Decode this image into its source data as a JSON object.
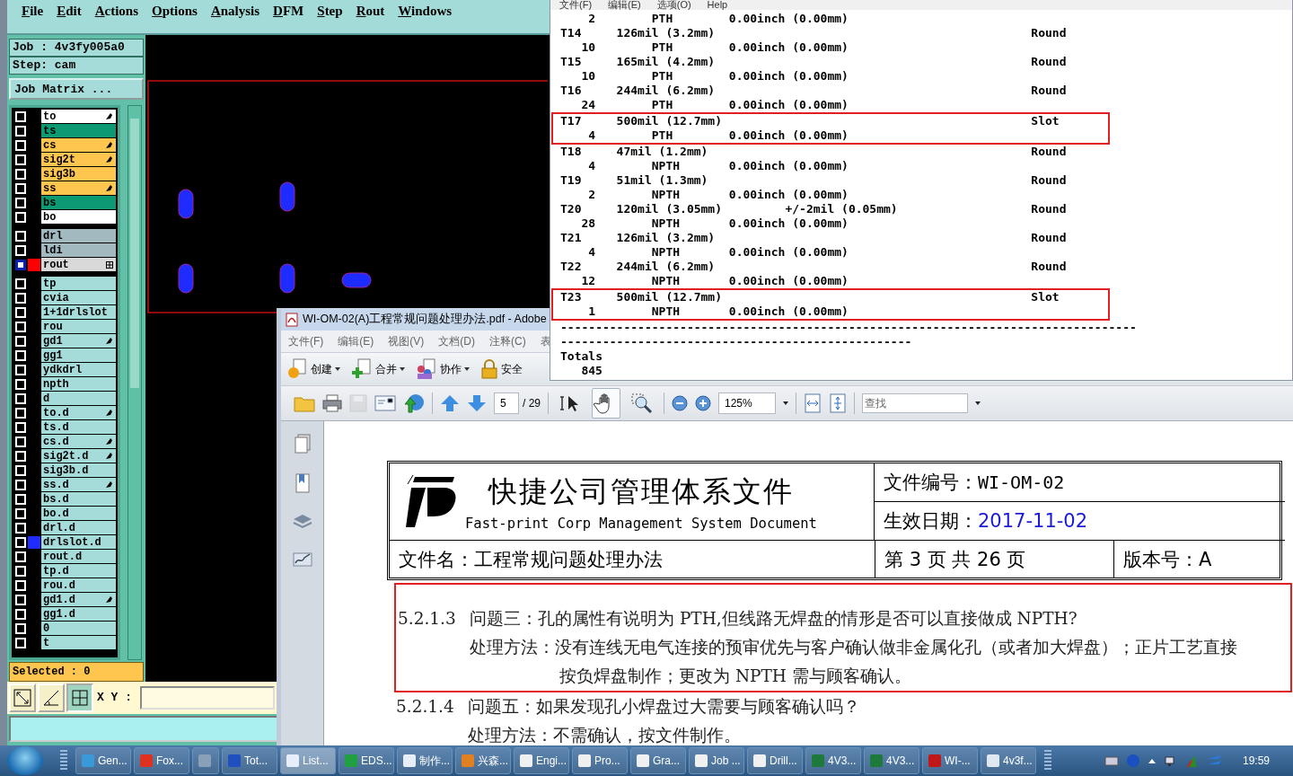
{
  "genesis": {
    "menu": [
      "File",
      "Edit",
      "Actions",
      "Options",
      "Analysis",
      "DFM",
      "Step",
      "Rout",
      "Windows"
    ],
    "job_label": "Job : 4v3fy005a0",
    "step_label": "Step: cam",
    "job_matrix_button": "Job Matrix ...",
    "layer_groups": [
      [
        {
          "name": "to",
          "color": "#ffffff",
          "kind": "hand",
          "active": false
        },
        {
          "name": "ts",
          "color": "#0c9a72",
          "kind": "plain",
          "active": false
        },
        {
          "name": "cs",
          "color": "#ffc64f",
          "kind": "hand",
          "active": false
        },
        {
          "name": "sig2t",
          "color": "#ffc64f",
          "kind": "hand",
          "active": false
        },
        {
          "name": "sig3b",
          "color": "#ffc64f",
          "kind": "plain",
          "active": false
        },
        {
          "name": "ss",
          "color": "#ffc64f",
          "kind": "hand",
          "active": false
        },
        {
          "name": "bs",
          "color": "#0c9a72",
          "kind": "plain",
          "active": false
        },
        {
          "name": "bo",
          "color": "#ffffff",
          "kind": "plain",
          "active": false
        }
      ],
      [
        {
          "name": "drl",
          "color": "#a3b9c0",
          "kind": "plain",
          "active": false
        },
        {
          "name": "ldi",
          "color": "#a3b9c0",
          "kind": "plain",
          "active": false
        },
        {
          "name": "rout",
          "color": "#d9d9d9",
          "swatch": {
            "color": "#ff0000"
          },
          "kind": "grid",
          "active": true
        }
      ],
      [
        {
          "name": "tp",
          "color": "#a5dcd9",
          "kind": "plain",
          "active": false
        },
        {
          "name": "cvia",
          "color": "#a5dcd9",
          "kind": "plain",
          "active": false
        },
        {
          "name": "1+1drlslot",
          "color": "#a5dcd9",
          "kind": "plain",
          "active": false
        },
        {
          "name": "rou",
          "color": "#a5dcd9",
          "kind": "plain",
          "active": false
        },
        {
          "name": "gd1",
          "color": "#a5dcd9",
          "kind": "hand",
          "active": false
        },
        {
          "name": "gg1",
          "color": "#a5dcd9",
          "kind": "plain",
          "active": false
        },
        {
          "name": "ydkdrl",
          "color": "#a5dcd9",
          "kind": "plain",
          "active": false
        },
        {
          "name": "npth",
          "color": "#a5dcd9",
          "kind": "plain",
          "active": false
        },
        {
          "name": "d",
          "color": "#a5dcd9",
          "kind": "plain",
          "active": false
        },
        {
          "name": "to.d",
          "color": "#a5dcd9",
          "kind": "hand",
          "active": false
        },
        {
          "name": "ts.d",
          "color": "#a5dcd9",
          "kind": "plain",
          "active": false
        },
        {
          "name": "cs.d",
          "color": "#a5dcd9",
          "kind": "hand",
          "active": false
        },
        {
          "name": "sig2t.d",
          "color": "#a5dcd9",
          "kind": "hand",
          "active": false
        },
        {
          "name": "sig3b.d",
          "color": "#a5dcd9",
          "kind": "plain",
          "active": false
        },
        {
          "name": "ss.d",
          "color": "#a5dcd9",
          "kind": "hand",
          "active": false
        },
        {
          "name": "bs.d",
          "color": "#a5dcd9",
          "kind": "plain",
          "active": false
        },
        {
          "name": "bo.d",
          "color": "#a5dcd9",
          "kind": "plain",
          "active": false
        },
        {
          "name": "drl.d",
          "color": "#a5dcd9",
          "kind": "plain",
          "active": false
        },
        {
          "name": "drlslot.d",
          "color": "#a5dcd9",
          "swatch": {
            "color": "#1f2cff"
          },
          "kind": "plain",
          "active": false
        },
        {
          "name": "rout.d",
          "color": "#a5dcd9",
          "kind": "plain",
          "active": false
        },
        {
          "name": "tp.d",
          "color": "#a5dcd9",
          "kind": "plain",
          "active": false
        },
        {
          "name": "rou.d",
          "color": "#a5dcd9",
          "kind": "plain",
          "active": false
        },
        {
          "name": "gd1.d",
          "color": "#a5dcd9",
          "kind": "hand",
          "active": false
        },
        {
          "name": "gg1.d",
          "color": "#a5dcd9",
          "kind": "plain",
          "active": false
        },
        {
          "name": "0",
          "color": "#a5dcd9",
          "kind": "plain",
          "active": false
        },
        {
          "name": "t",
          "color": "#a5dcd9",
          "kind": "plain",
          "active": false
        }
      ]
    ],
    "selected_label": "Selected : 0",
    "tool_buttons": [
      {
        "kind": "zoom-fit",
        "selected": false
      },
      {
        "kind": "measure",
        "selected": false
      },
      {
        "kind": "grid",
        "selected": true
      }
    ],
    "coordinates_label": "X Y :"
  },
  "report": {
    "menu": [
      "文件(F)",
      "编辑(E)",
      "选项(O)",
      "Help"
    ],
    "entries": [
      {
        "count": "2",
        "type": "PTH",
        "plating": "0.00inch (0.00mm)",
        "highlighted": false
      },
      {
        "tool": "T14",
        "size": "126mil (3.2mm)",
        "shape": "Round",
        "count": "10",
        "type": "PTH",
        "plating": "0.00inch (0.00mm)",
        "highlighted": false
      },
      {
        "tool": "T15",
        "size": "165mil (4.2mm)",
        "shape": "Round",
        "count": "10",
        "type": "PTH",
        "plating": "0.00inch (0.00mm)",
        "highlighted": false
      },
      {
        "tool": "T16",
        "size": "244mil (6.2mm)",
        "shape": "Round",
        "count": "24",
        "type": "PTH",
        "plating": "0.00inch (0.00mm)",
        "highlighted": false
      },
      {
        "tool": "T17",
        "size": "500mil (12.7mm)",
        "shape": "Slot",
        "count": "4",
        "type": "PTH",
        "plating": "0.00inch (0.00mm)",
        "highlighted": true
      },
      {
        "tool": "T18",
        "size": "47mil (1.2mm)",
        "shape": "Round",
        "count": "4",
        "type": "NPTH",
        "plating": "0.00inch (0.00mm)",
        "highlighted": false
      },
      {
        "tool": "T19",
        "size": "51mil (1.3mm)",
        "shape": "Round",
        "count": "2",
        "type": "NPTH",
        "plating": "0.00inch (0.00mm)",
        "highlighted": false
      },
      {
        "tool": "T20",
        "size": "120mil (3.05mm)",
        "tolerance": "+/-2mil (0.05mm)",
        "shape": "Round",
        "count": "28",
        "type": "NPTH",
        "plating": "0.00inch (0.00mm)",
        "highlighted": false
      },
      {
        "tool": "T21",
        "size": "126mil (3.2mm)",
        "shape": "Round",
        "count": "4",
        "type": "NPTH",
        "plating": "0.00inch (0.00mm)",
        "highlighted": false
      },
      {
        "tool": "T22",
        "size": "244mil (6.2mm)",
        "shape": "Round",
        "count": "12",
        "type": "NPTH",
        "plating": "0.00inch (0.00mm)",
        "highlighted": false
      },
      {
        "tool": "T23",
        "size": "500mil (12.7mm)",
        "shape": "Slot",
        "count": "1",
        "type": "NPTH",
        "plating": "0.00inch (0.00mm)",
        "highlighted": true
      }
    ],
    "rules": [
      "----------------------------------------------------------------------------------",
      "--------------------------------------------------"
    ],
    "totals_label": "Totals",
    "totals_value": "845"
  },
  "pdf": {
    "title": "WI-OM-02(A)工程常规问题处理办法.pdf - Adobe",
    "menu": [
      "文件(F)",
      "编辑(E)",
      "视图(V)",
      "文档(D)",
      "注释(C)",
      "表"
    ],
    "tasks": [
      {
        "label": "创建",
        "kind": "create",
        "dropdown": true
      },
      {
        "label": "合并",
        "kind": "combine",
        "dropdown": true
      },
      {
        "label": "协作",
        "kind": "collaborate",
        "dropdown": true
      },
      {
        "label": "安全",
        "kind": "lock",
        "dropdown": false
      }
    ],
    "file_buttons": [
      {
        "kind": "folder",
        "disabled": false
      },
      {
        "kind": "printer",
        "disabled": false
      },
      {
        "kind": "floppy",
        "disabled": true
      },
      {
        "kind": "envelope",
        "disabled": false
      },
      {
        "kind": "globe",
        "disabled": false
      }
    ],
    "page_field": "5",
    "page_count": "/ 29",
    "tools": [
      {
        "kind": "select",
        "selected": false
      },
      {
        "kind": "hand",
        "selected": true
      },
      {
        "kind": "marquee",
        "selected": false
      }
    ],
    "zoom_field": "125%",
    "search_placeholder": "查找",
    "nav_icons": [
      {
        "kind": "pages"
      },
      {
        "kind": "bookmarks"
      },
      {
        "kind": "layers"
      },
      {
        "kind": "signatures"
      }
    ],
    "document": {
      "company_title": "快捷公司管理体系文件",
      "company_subtitle": "Fast-print Corp Management System Document",
      "doc_number_label": "文件编号：",
      "doc_number": "WI-OM-02",
      "effective_label": "生效日期：",
      "effective_date": "2017-11-02",
      "file_name": "文件名：工程常规问题处理办法",
      "page_info": "第 3 页 共 26 页",
      "version": "版本号：A",
      "sections": [
        {
          "number": "5.2.1.3",
          "title": "问题三：孔的属性有说明为 PTH,但线路无焊盘的情形是否可以直接做成 NPTH?",
          "method": [
            "处理方法：没有连线无电气连接的预审优先与客户确认做非金属化孔（或者加大焊盘）；正片工艺直接",
            "按负焊盘制作；更改为 NPTH 需与顾客确认。"
          ],
          "highlighted": true
        },
        {
          "number": "5.2.1.4",
          "title": "问题五：如果发现孔小焊盘过大需要与顾客确认吗？",
          "method": [
            "处理方法：不需确认，按文件制作。"
          ],
          "highlighted": false
        }
      ]
    }
  },
  "taskbar": {
    "items": [
      {
        "label": "Gen...",
        "kind": "gear",
        "selected": false
      },
      {
        "label": "Fox...",
        "kind": "foxit",
        "selected": false
      },
      {
        "kind": "calculator",
        "selected": false
      },
      {
        "label": "Tot...",
        "kind": "floppy",
        "selected": false
      },
      {
        "label": "List...",
        "kind": "list",
        "selected": true
      },
      {
        "label": "EDS...",
        "kind": "eds",
        "selected": false
      },
      {
        "label": "制作...",
        "kind": "list",
        "selected": false
      },
      {
        "label": "兴森...",
        "kind": "star",
        "selected": false
      },
      {
        "label": "Engi...",
        "kind": "window",
        "selected": false
      },
      {
        "label": "Pro...",
        "kind": "window",
        "selected": false
      },
      {
        "label": "Gra...",
        "kind": "window",
        "selected": false
      },
      {
        "label": "Job ...",
        "kind": "window",
        "selected": false
      },
      {
        "label": "Drill...",
        "kind": "window",
        "selected": false
      },
      {
        "label": "4V3...",
        "kind": "sheet",
        "selected": false
      },
      {
        "label": "4V3...",
        "kind": "sheet",
        "selected": false
      },
      {
        "label": "WI-...",
        "kind": "pdf",
        "selected": false
      },
      {
        "label": "4v3f...",
        "kind": "notepad",
        "selected": false
      }
    ],
    "clock": "19:59"
  }
}
